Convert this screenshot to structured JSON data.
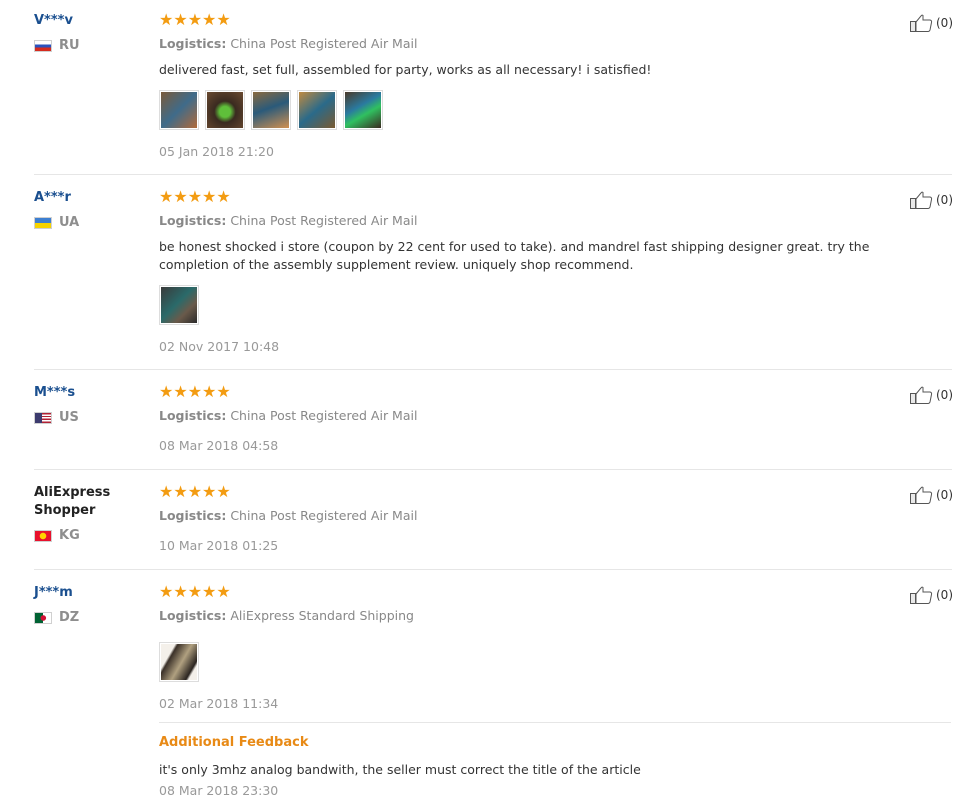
{
  "reviews": [
    {
      "user": "V***v",
      "country": "RU",
      "rating": "★★★★★",
      "logistics_label": "Logistics:",
      "logistics_value": "China Post Registered Air Mail",
      "text": "delivered fast, set full, assembled for party, works as all necessary! i satisfied!",
      "photo_count": 5,
      "date": "05 Jan 2018 21:20",
      "helpful": "(0)"
    },
    {
      "user": "A***r",
      "country": "UA",
      "rating": "★★★★★",
      "logistics_label": "Logistics:",
      "logistics_value": "China Post Registered Air Mail",
      "text": "be honest shocked i store (coupon by 22 cent for used to take). and mandrel fast shipping designer great. try the completion of the assembly supplement review. uniquely shop recommend.",
      "photo_count": 1,
      "date": "02 Nov 2017 10:48",
      "helpful": "(0)"
    },
    {
      "user": "M***s",
      "country": "US",
      "rating": "★★★★★",
      "logistics_label": "Logistics:",
      "logistics_value": "China Post Registered Air Mail",
      "date": "08 Mar 2018 04:58",
      "helpful": "(0)"
    },
    {
      "user": "AliExpress Shopper",
      "country": "KG",
      "rating": "★★★★★",
      "logistics_label": "Logistics:",
      "logistics_value": "China Post Registered Air Mail",
      "date": "10 Mar 2018 01:25",
      "helpful": "(0)"
    },
    {
      "user": "J***m",
      "country": "DZ",
      "rating": "★★★★★",
      "logistics_label": "Logistics:",
      "logistics_value": "AliExpress Standard Shipping",
      "photo_count": 1,
      "date": "02 Mar 2018 11:34",
      "helpful": "(0)",
      "additional_feedback_title": "Additional Feedback",
      "additional_feedback_text": "it's only 3mhz analog bandwith, the seller must correct the title of the article",
      "additional_feedback_date": "08 Mar 2018 23:30"
    }
  ],
  "colors": {
    "username": "#1a4f8f",
    "star": "#f39c12",
    "additional_title": "#e88a16"
  },
  "icons": {
    "helpful": "thumbs-up-icon"
  }
}
